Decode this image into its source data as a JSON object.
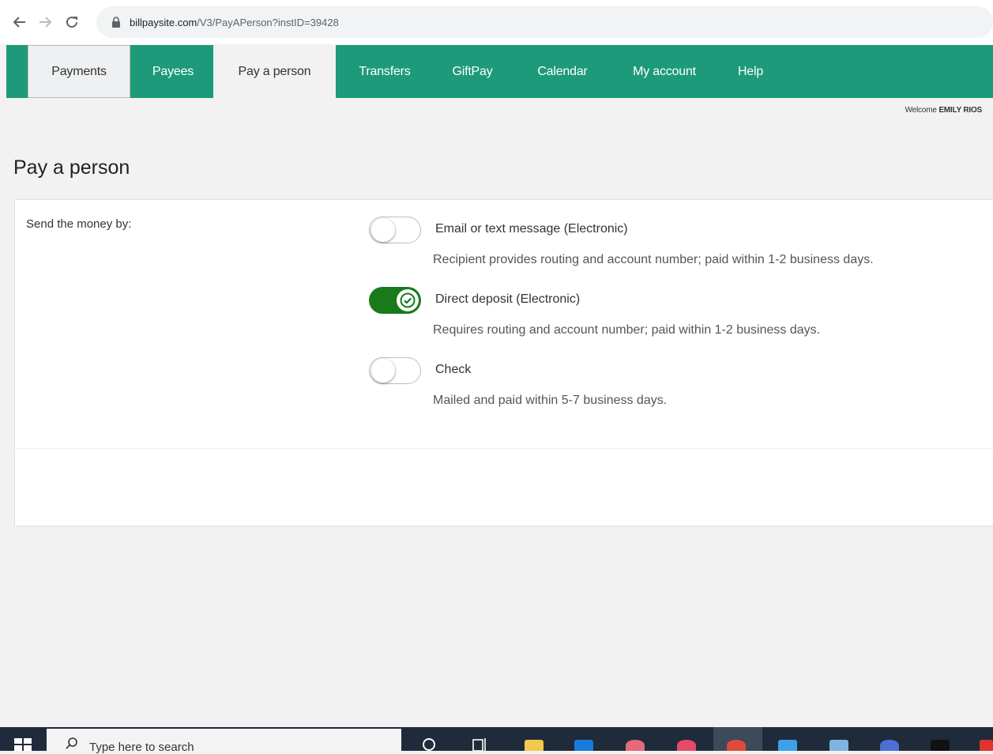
{
  "browser": {
    "url_host": "billpaysite.com",
    "url_path": "/V3/PayAPerson?instID=39428"
  },
  "nav": {
    "tabs": [
      {
        "label": "Payments"
      },
      {
        "label": "Payees"
      },
      {
        "label": "Pay a person"
      },
      {
        "label": "Transfers"
      },
      {
        "label": "GiftPay"
      },
      {
        "label": "Calendar"
      },
      {
        "label": "My account"
      },
      {
        "label": "Help"
      }
    ],
    "active_tab": "Pay a person",
    "color": "#1d9a79"
  },
  "welcome": {
    "prefix": "Welcome",
    "user": "EMILY RIOS"
  },
  "page": {
    "title": "Pay a person"
  },
  "form": {
    "send_label": "Send the money by:",
    "options": [
      {
        "title": "Email or text message (Electronic)",
        "description": "Recipient provides routing and account number; paid within 1-2 business days.",
        "selected": false
      },
      {
        "title": "Direct deposit (Electronic)",
        "description": "Requires routing and account number; paid within 1-2 business days.",
        "selected": true
      },
      {
        "title": "Check",
        "description": "Mailed and paid within 5-7 business days.",
        "selected": false
      }
    ],
    "toggle_on_color": "#187a1b"
  },
  "taskbar": {
    "search_placeholder": "Type here to search",
    "icons": [
      "search-icon",
      "task-view-icon",
      "file-explorer-icon",
      "mail-icon",
      "app-icon",
      "music-icon",
      "chrome-icon",
      "photos-icon",
      "app-icon",
      "word-icon",
      "app-icon",
      "app-icon"
    ]
  }
}
